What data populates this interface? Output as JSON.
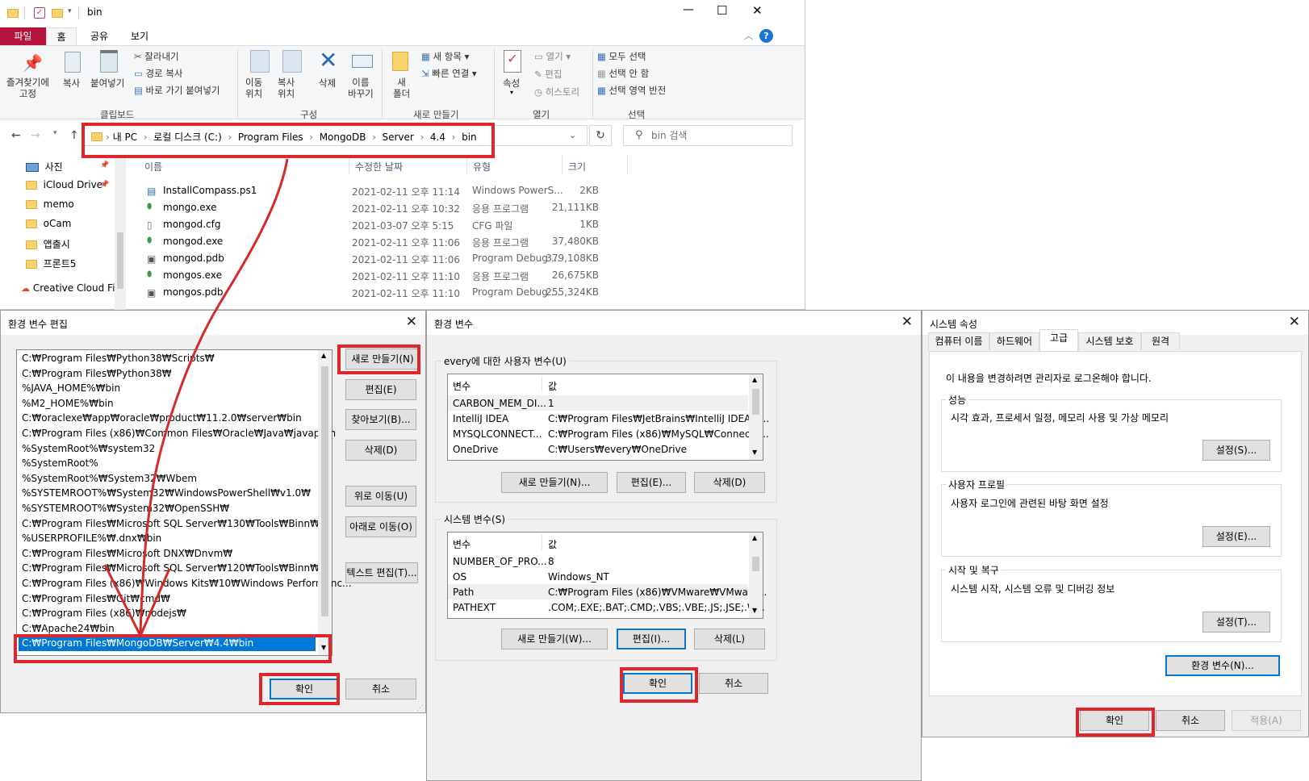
{
  "explorer": {
    "title": "bin",
    "window_controls": [
      "—",
      "☐",
      "✕"
    ],
    "tabs": [
      {
        "label": "파일",
        "selected": false,
        "accent": "#b5153c"
      },
      {
        "label": "홈",
        "selected": true
      },
      {
        "label": "공유",
        "selected": false
      },
      {
        "label": "보기",
        "selected": false
      }
    ],
    "help_label": "?",
    "ribbon": {
      "pin_label": "즐겨찾기에\n고정",
      "copy_label": "복사",
      "paste_label": "붙여넣기",
      "cut_label": "잘라내기",
      "copy_path_label": "경로 복사",
      "paste_shortcut_label": "바로 가기 붙여넣기",
      "clipboard_group": "클립보드",
      "move_to_label": "이동\n위치",
      "copy_to_label": "복사\n위치",
      "delete_label": "삭제",
      "rename_label": "이름\n바꾸기",
      "organize_group": "구성",
      "new_folder_label": "새\n폴더",
      "new_item_label": "새 항목",
      "easy_access_label": "빠른 연결",
      "new_group": "새로 만들기",
      "properties_label": "속성",
      "open_label": "열기",
      "edit_label": "편집",
      "history_label": "히스토리",
      "open_group": "열기",
      "select_all_label": "모두 선택",
      "select_none_label": "선택 안 함",
      "invert_selection_label": "선택 영역 반전",
      "select_group": "선택"
    },
    "breadcrumb": [
      "내 PC",
      "로컬 디스크 (C:)",
      "Program Files",
      "MongoDB",
      "Server",
      "4.4",
      "bin"
    ],
    "search_placeholder": "bin 검색",
    "columns": [
      "이름",
      "수정한 날짜",
      "유형",
      "크기"
    ],
    "files": [
      {
        "name": "InstallCompass.ps1",
        "date": "2021-02-11 오후 11:14",
        "type": "Windows PowerS...",
        "size": "2KB",
        "icon": "script-file-icon"
      },
      {
        "name": "mongo.exe",
        "date": "2021-02-11 오후 10:32",
        "type": "응용 프로그램",
        "size": "21,111KB",
        "icon": "mongo-leaf-icon"
      },
      {
        "name": "mongod.cfg",
        "date": "2021-03-07 오후 5:15",
        "type": "CFG 파일",
        "size": "1KB",
        "icon": "file-icon"
      },
      {
        "name": "mongod.exe",
        "date": "2021-02-11 오후 11:06",
        "type": "응용 프로그램",
        "size": "37,480KB",
        "icon": "mongo-leaf-icon"
      },
      {
        "name": "mongod.pdb",
        "date": "2021-02-11 오후 11:06",
        "type": "Program Debug ...",
        "size": "379,108KB",
        "icon": "pdb-file-icon"
      },
      {
        "name": "mongos.exe",
        "date": "2021-02-11 오후 11:10",
        "type": "응용 프로그램",
        "size": "26,675KB",
        "icon": "mongo-leaf-icon"
      },
      {
        "name": "mongos.pdb",
        "date": "2021-02-11 오후 11:10",
        "type": "Program Debug ...",
        "size": "255,324KB",
        "icon": "pdb-file-icon"
      }
    ],
    "nav": [
      "사진",
      "iCloud Drive",
      "memo",
      "oCam",
      "앱출시",
      "프론트5",
      "Creative Cloud Fil"
    ]
  },
  "edit_env": {
    "title": "환경 변수 편집",
    "paths": [
      "C:₩Program Files₩Python38₩Scripts₩",
      "C:₩Program Files₩Python38₩",
      "%JAVA_HOME%₩bin",
      "%M2_HOME%₩bin",
      "C:₩oraclexe₩app₩oracle₩product₩11.2.0₩server₩bin",
      "C:₩Program Files (x86)₩Common Files₩Oracle₩Java₩javapath",
      "%SystemRoot%₩system32",
      "%SystemRoot%",
      "%SystemRoot%₩System32₩Wbem",
      "%SYSTEMROOT%₩System32₩WindowsPowerShell₩v1.0₩",
      "%SYSTEMROOT%₩System32₩OpenSSH₩",
      "C:₩Program Files₩Microsoft SQL Server₩130₩Tools₩Binn₩",
      "%USERPROFILE%₩.dnx₩bin",
      "C:₩Program Files₩Microsoft DNX₩Dnvm₩",
      "C:₩Program Files₩Microsoft SQL Server₩120₩Tools₩Binn₩",
      "C:₩Program Files (x86)₩Windows Kits₩10₩Windows Performanc...",
      "C:₩Program Files₩Git₩cmd₩",
      "C:₩Program Files (x86)₩nodejs₩",
      "C:₩Apache24₩bin",
      "C:₩Program Files₩MongoDB₩Server₩4.4₩bin"
    ],
    "selected_index": 19,
    "buttons": {
      "new": "새로 만들기(N)",
      "edit": "편집(E)",
      "browse": "찾아보기(B)...",
      "delete": "삭제(D)",
      "move_up": "위로 이동(U)",
      "move_down": "아래로 이동(O)",
      "edit_text": "텍스트 편집(T)...",
      "ok": "확인",
      "cancel": "취소"
    }
  },
  "env_vars": {
    "title": "환경 변수",
    "user_group": "every에 대한 사용자 변수(U)",
    "col_var": "변수",
    "col_value": "값",
    "user_vars": [
      {
        "name": "CARBON_MEM_DI...",
        "value": "1"
      },
      {
        "name": "IntelliJ IDEA",
        "value": "C:₩Program Files₩JetBrains₩IntelliJ IDEA 2..."
      },
      {
        "name": "MYSQLCONNECT...",
        "value": "C:₩Program Files (x86)₩MySQL₩Connecto..."
      },
      {
        "name": "OneDrive",
        "value": "C:₩Users₩every₩OneDrive"
      }
    ],
    "user_buttons": {
      "new": "새로 만들기(N)...",
      "edit": "편집(E)...",
      "delete": "삭제(D)"
    },
    "system_group": "시스템 변수(S)",
    "system_vars": [
      {
        "name": "NUMBER_OF_PRO...",
        "value": "8"
      },
      {
        "name": "OS",
        "value": "Windows_NT"
      },
      {
        "name": "Path",
        "value": "C:₩Program Files (x86)₩VMware₩VMware..."
      },
      {
        "name": "PATHEXT",
        "value": ".COM;.EXE;.BAT;.CMD;.VBS;.VBE;.JS;.JSE;.W..."
      }
    ],
    "system_buttons": {
      "new": "새로 만들기(W)...",
      "edit": "편집(I)...",
      "delete": "삭제(L)"
    },
    "ok": "확인",
    "cancel": "취소"
  },
  "sys_props": {
    "title": "시스템 속성",
    "tabs": [
      "컴퓨터 이름",
      "하드웨어",
      "고급",
      "시스템 보호",
      "원격"
    ],
    "selected_tab": 2,
    "admin_note": "이 내용을 변경하려면 관리자로 로그온해야 합니다.",
    "perf_group": "성능",
    "perf_desc": "시각 효과, 프로세서 일정, 메모리 사용 및 가상 메모리",
    "perf_btn": "설정(S)...",
    "profile_group": "사용자 프로필",
    "profile_desc": "사용자 로그인에 관련된 바탕 화면 설정",
    "profile_btn": "설정(E)...",
    "startup_group": "시작 및 복구",
    "startup_desc": "시스템 시작, 시스템 오류 및 디버깅 정보",
    "startup_btn": "설정(T)...",
    "env_btn": "환경 변수(N)...",
    "ok": "확인",
    "cancel": "취소",
    "apply": "적용(A)"
  },
  "colors": {
    "highlight_red": "#e0262b",
    "selection_blue": "#0078d7",
    "file_tab": "#b5153c"
  }
}
